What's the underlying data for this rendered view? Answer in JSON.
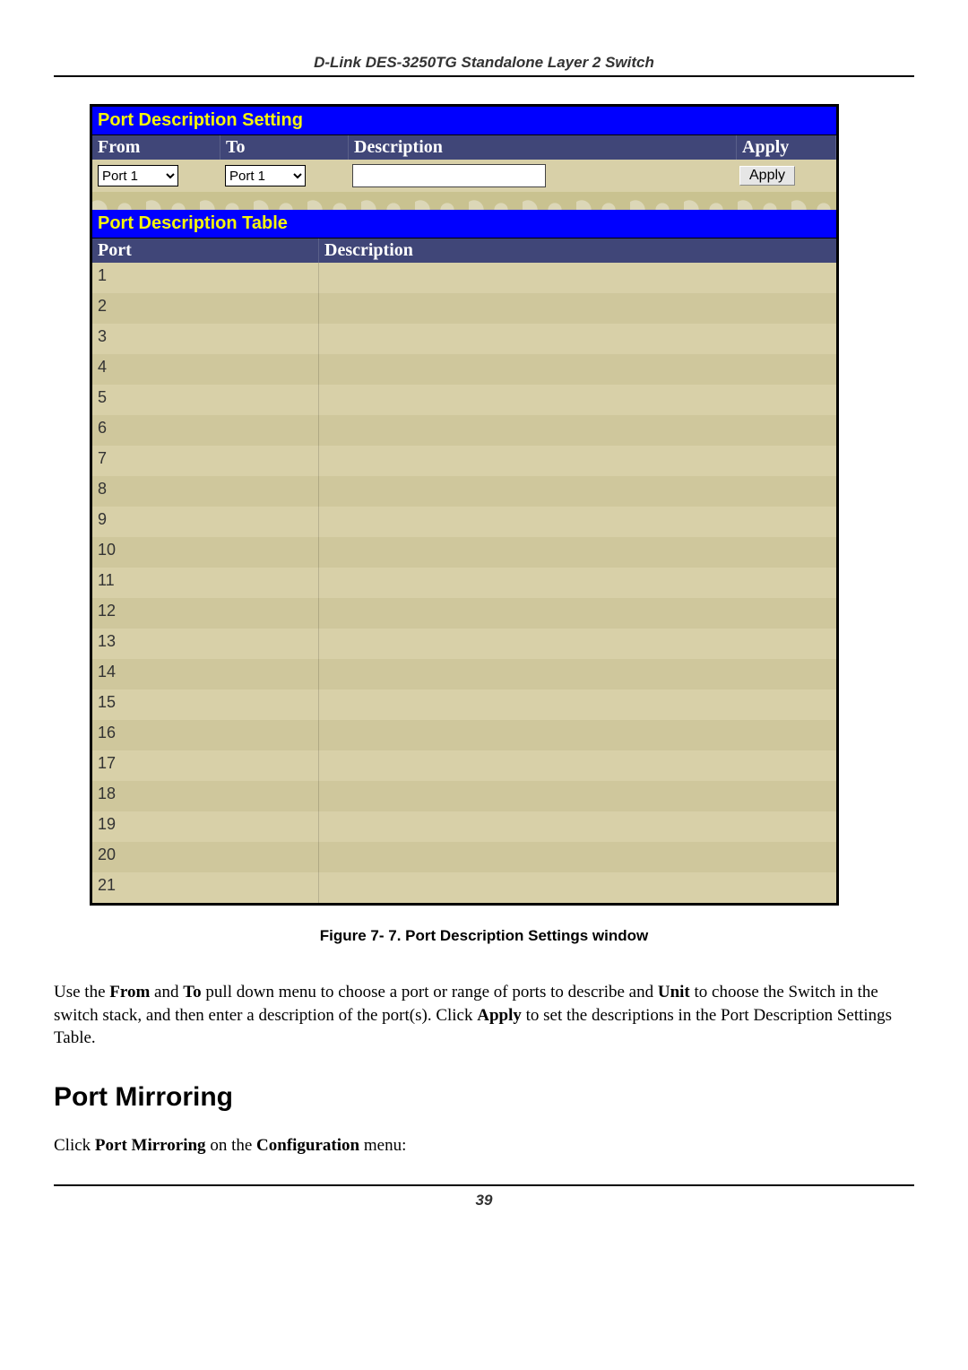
{
  "doc": {
    "header": "D-Link DES-3250TG Standalone Layer 2 Switch",
    "page_number": "39"
  },
  "panel": {
    "setting_title": "Port Description Setting",
    "cols": {
      "from": "From",
      "to": "To",
      "desc": "Description",
      "apply": "Apply"
    },
    "from_value": "Port 1",
    "to_value": "Port 1",
    "desc_value": "",
    "apply_label": "Apply",
    "table_title": "Port Description Table",
    "table_cols": {
      "port": "Port",
      "desc": "Description"
    },
    "rows": [
      {
        "port": "1",
        "desc": ""
      },
      {
        "port": "2",
        "desc": ""
      },
      {
        "port": "3",
        "desc": ""
      },
      {
        "port": "4",
        "desc": ""
      },
      {
        "port": "5",
        "desc": ""
      },
      {
        "port": "6",
        "desc": ""
      },
      {
        "port": "7",
        "desc": ""
      },
      {
        "port": "8",
        "desc": ""
      },
      {
        "port": "9",
        "desc": ""
      },
      {
        "port": "10",
        "desc": ""
      },
      {
        "port": "11",
        "desc": ""
      },
      {
        "port": "12",
        "desc": ""
      },
      {
        "port": "13",
        "desc": ""
      },
      {
        "port": "14",
        "desc": ""
      },
      {
        "port": "15",
        "desc": ""
      },
      {
        "port": "16",
        "desc": ""
      },
      {
        "port": "17",
        "desc": ""
      },
      {
        "port": "18",
        "desc": ""
      },
      {
        "port": "19",
        "desc": ""
      },
      {
        "port": "20",
        "desc": ""
      },
      {
        "port": "21",
        "desc": ""
      }
    ]
  },
  "figure_caption": "Figure 7- 7. Port Description Settings window",
  "paragraph": {
    "p1a": "Use the ",
    "p1b": "From",
    "p1c": " and ",
    "p1d": "To",
    "p1e": " pull down menu to choose a port or range of ports to describe and ",
    "p1f": "Unit",
    "p1g": " to choose the Switch in the switch stack, and then enter a description of the port(s). Click ",
    "p1h": "Apply",
    "p1i": " to set the descriptions in the Port Description Settings Table."
  },
  "heading": "Port Mirroring",
  "paragraph2": {
    "a": "Click ",
    "b": "Port Mirroring",
    "c": " on the ",
    "d": "Configuration",
    "e": " menu:"
  }
}
